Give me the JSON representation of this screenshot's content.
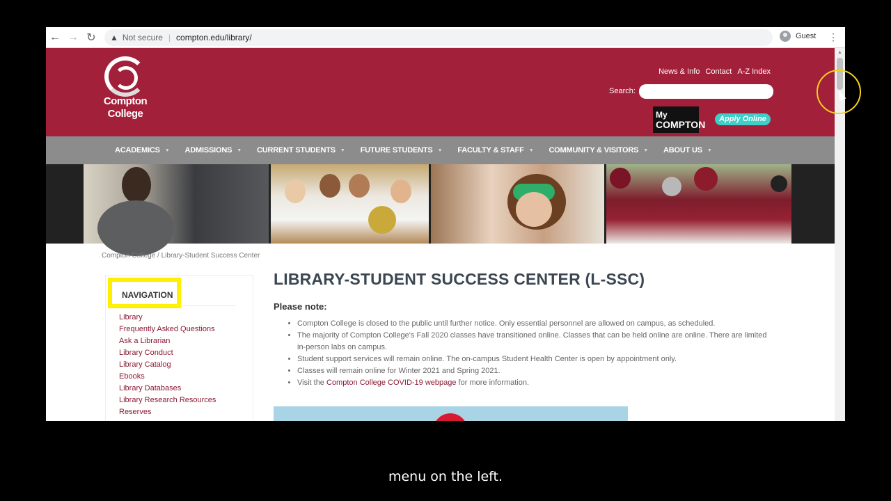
{
  "browser": {
    "back_icon": "arrow-left-icon",
    "forward_icon": "arrow-right-icon",
    "reload_icon": "reload-icon",
    "security_label": "Not secure",
    "url": "compton.edu/library/",
    "profile_label": "Guest"
  },
  "header": {
    "logo_line1": "Compton",
    "logo_line2": "College",
    "toplinks": [
      "News & Info",
      "Contact",
      "A-Z Index"
    ],
    "search_label": "Search:",
    "search_value": "",
    "mycompton_line1": "My",
    "mycompton_line2": "COMPTON",
    "apply_label": "Apply Online"
  },
  "mainnav": [
    "ACADEMICS",
    "ADMISSIONS",
    "CURRENT STUDENTS",
    "FUTURE STUDENTS",
    "FACULTY & STAFF",
    "COMMUNITY & VISITORS",
    "ABOUT US"
  ],
  "breadcrumb": "Compton College / Library-Student Success Center",
  "sidebar": {
    "heading": "NAVIGATION",
    "items": [
      "Library",
      "Frequently Asked Questions",
      "Ask a Librarian",
      "Library Conduct",
      "Library Catalog",
      "Ebooks",
      "Library Databases",
      "Library Research Resources",
      "Reserves"
    ]
  },
  "main": {
    "title": "LIBRARY-STUDENT SUCCESS CENTER (L-SSC)",
    "note_heading": "Please note:",
    "notes": [
      "Compton College  is closed to the public until further notice. Only essential personnel are allowed on campus, as scheduled.",
      "The majority of Compton College's Fall 2020 classes have transitioned online. Classes that can be held online are online. There are limited in-person labs on campus.",
      "Student support services will remain online. The on-campus Student Health Center is open by appointment only.",
      "Classes will remain online for Winter 2021 and Spring 2021."
    ],
    "last_note_prefix": "Visit the ",
    "last_note_link": "Compton College COVID-19 webpage",
    "last_note_suffix": " for more information."
  },
  "caption": "menu on the left.",
  "colors": {
    "brand": "#a3203a",
    "nav_gray": "#8c8c8c",
    "link": "#8b1a32",
    "highlight": "#ffef00",
    "apply": "#3ecfc8"
  }
}
